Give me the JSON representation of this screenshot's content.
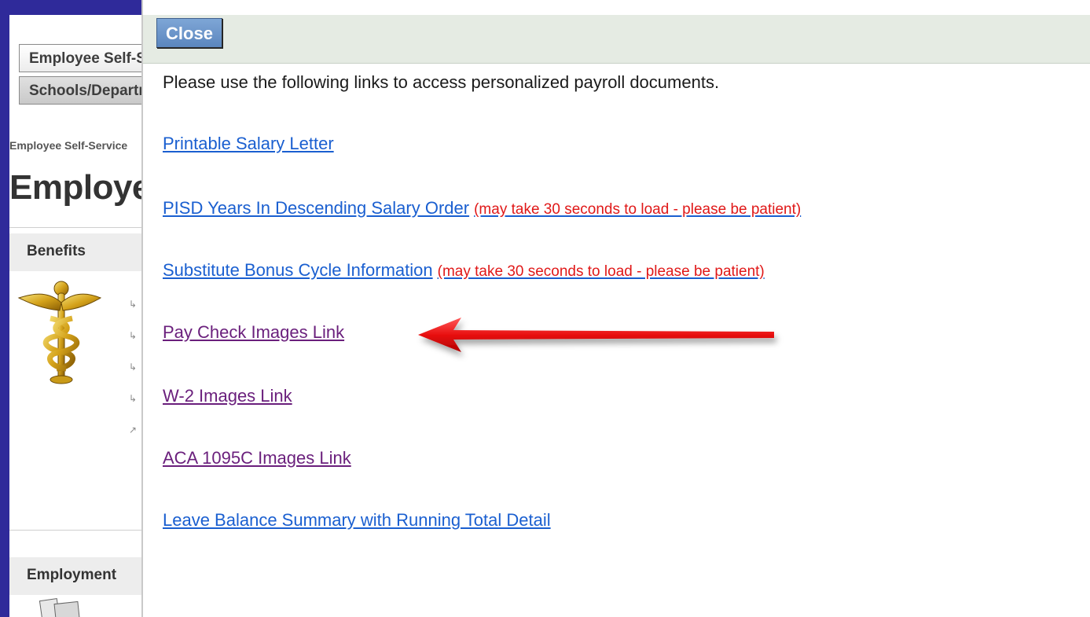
{
  "background": {
    "tabs": [
      "Employee Self-Service",
      "Schools/Departments"
    ],
    "breadcrumb": "Employee Self-Service",
    "title": "Employee",
    "sections": [
      "Benefits",
      "Employment"
    ]
  },
  "dialog": {
    "close_label": "Close",
    "intro": "Please use the following links to access personalized payroll documents.",
    "links": [
      {
        "label": "Printable Salary Letter",
        "note": ""
      },
      {
        "label": "PISD Years In Descending Salary Order",
        "note": "(may take 30 seconds to load - please be patient)"
      },
      {
        "label": "Substitute Bonus Cycle Information",
        "note": "(may take 30 seconds to load - please be patient)"
      },
      {
        "label": "Pay Check Images Link",
        "note": ""
      },
      {
        "label": "W-2 Images Link",
        "note": ""
      },
      {
        "label": "ACA 1095C Images Link",
        "note": ""
      },
      {
        "label": "Leave Balance Summary with Running Total Detail",
        "note": ""
      }
    ]
  },
  "colors": {
    "frame": "#2f2a9a",
    "link": "#1a5fd0",
    "visited_link": "#6a1f7c",
    "note": "#e01818",
    "arrow": "#e01818",
    "close_button": "#6b93c8"
  },
  "icons": [
    "caduceus-icon",
    "bullet-list-icon",
    "employment-icon",
    "arrow-annotation"
  ]
}
